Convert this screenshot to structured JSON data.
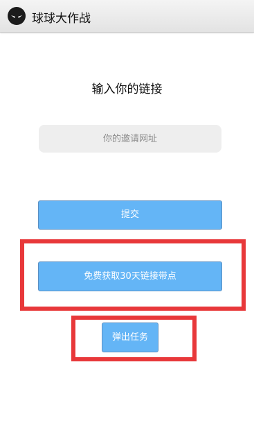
{
  "app": {
    "title": "球球大作战",
    "icon": "ninja-face-icon"
  },
  "form": {
    "heading": "输入你的链接",
    "invite_placeholder": "你的邀请网址",
    "invite_value": ""
  },
  "buttons": {
    "submit": "提交",
    "free_link": "免费获取30天链接带点",
    "popup_task": "弹出任务"
  },
  "colors": {
    "button_fill": "#64b5f6",
    "highlight": "#e8383a"
  }
}
